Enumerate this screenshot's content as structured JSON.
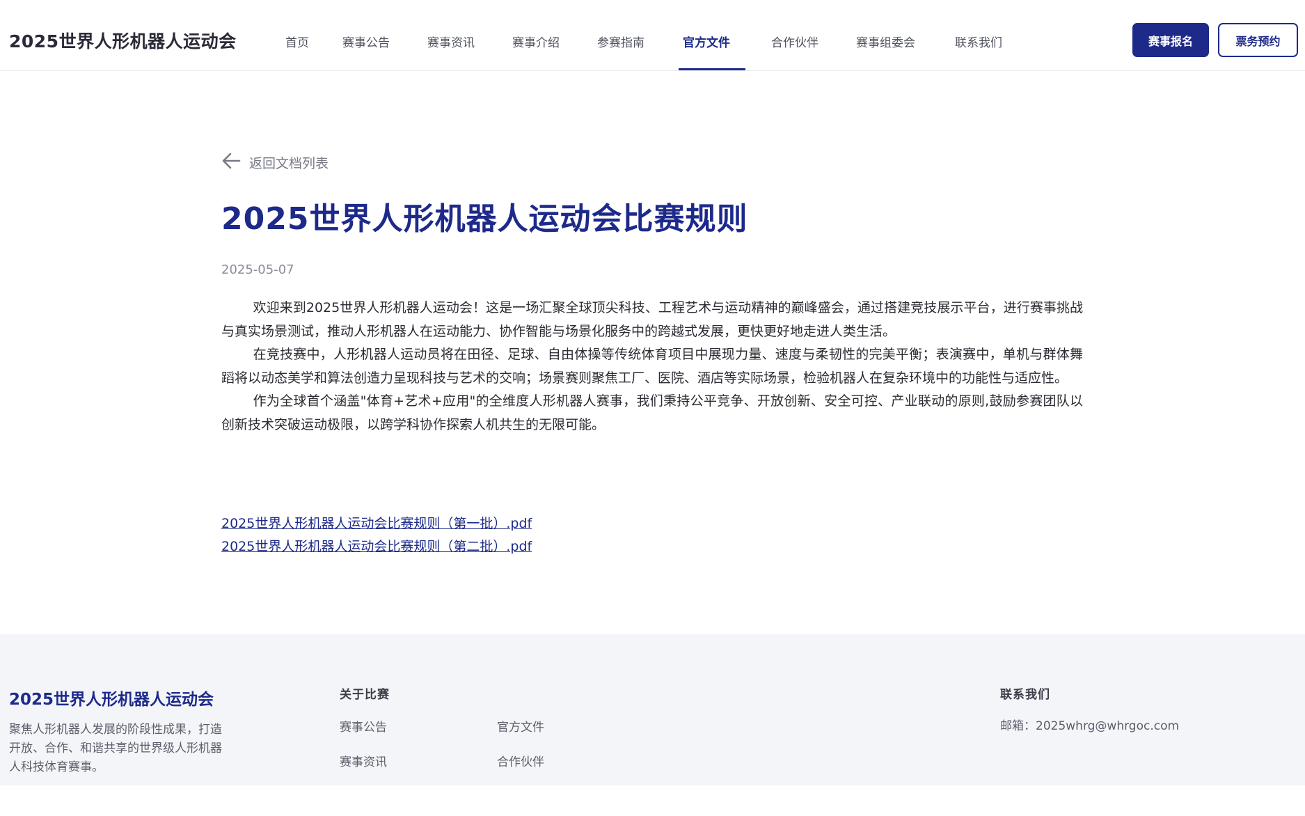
{
  "header": {
    "brand": "2025世界人形机器人运动会",
    "nav": [
      {
        "label": "首页"
      },
      {
        "label": "赛事公告"
      },
      {
        "label": "赛事资讯"
      },
      {
        "label": "赛事介绍"
      },
      {
        "label": "参赛指南"
      },
      {
        "label": "官方文件",
        "active": true
      },
      {
        "label": "合作伙伴"
      },
      {
        "label": "赛事组委会"
      },
      {
        "label": "联系我们"
      }
    ],
    "register_label": "赛事报名",
    "tickets_label": "票务预约"
  },
  "main": {
    "back_label": "返回文档列表",
    "title": "2025世界人形机器人运动会比赛规则",
    "date": "2025-05-07",
    "paragraphs": [
      "欢迎来到2025世界人形机器人运动会！这是一场汇聚全球顶尖科技、工程艺术与运动精神的巅峰盛会，通过搭建竞技展示平台，进行赛事挑战与真实场景测试，推动人形机器人在运动能力、协作智能与场景化服务中的跨越式发展，更快更好地走进人类生活。",
      "在竞技赛中，人形机器人运动员将在田径、足球、自由体操等传统体育项目中展现力量、速度与柔韧性的完美平衡；表演赛中，单机与群体舞蹈将以动态美学和算法创造力呈现科技与艺术的交响；场景赛则聚焦工厂、医院、酒店等实际场景，检验机器人在复杂环境中的功能性与适应性。",
      "作为全球首个涵盖\"体育+艺术+应用\"的全维度人形机器人赛事，我们秉持公平竞争、开放创新、安全可控、产业联动的原则,鼓励参赛团队以创新技术突破运动极限，以跨学科协作探索人机共生的无限可能。"
    ],
    "files": [
      "2025世界人形机器人运动会比赛规则（第一批）.pdf",
      "2025世界人形机器人运动会比赛规则（第二批）.pdf"
    ]
  },
  "footer": {
    "brand": "2025世界人形机器人运动会",
    "description": "聚焦人形机器人发展的阶段性成果，打造开放、合作、和谐共享的世界级人形机器人科技体育赛事。",
    "about_heading": "关于比赛",
    "about_links": [
      "赛事公告",
      "官方文件",
      "赛事资讯",
      "合作伙伴"
    ],
    "contact_heading": "联系我们",
    "contact_email": "邮箱：2025whrg@whrgoc.com"
  },
  "colors": {
    "primary": "#1d2a8a",
    "footer_bg": "#f4f5f9",
    "muted_text": "#8a8d98"
  },
  "icons": {
    "back": "arrow-left-icon"
  }
}
